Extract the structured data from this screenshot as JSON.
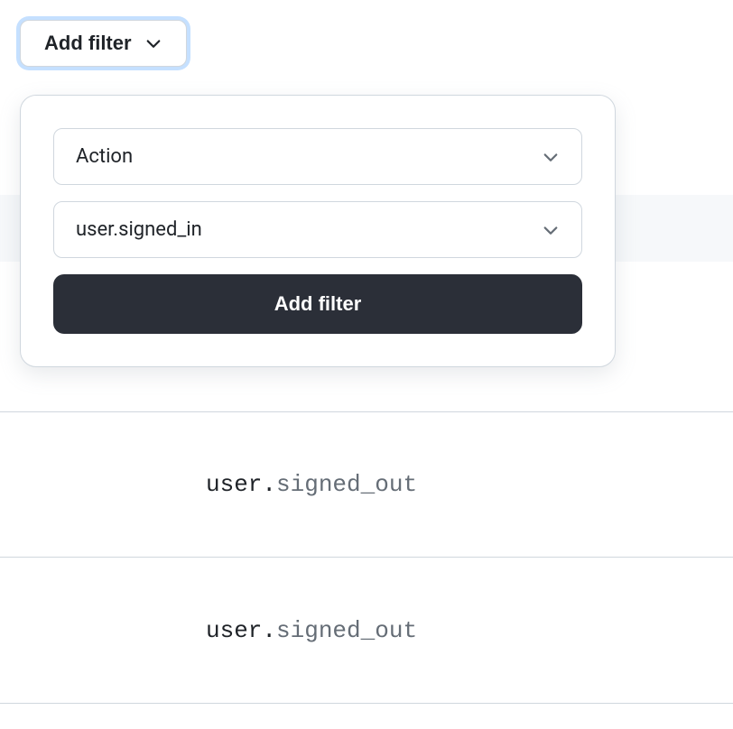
{
  "filter": {
    "trigger_label": "Add filter",
    "popover": {
      "select1_value": "Action",
      "select2_value": "user.signed_in",
      "submit_label": "Add filter"
    }
  },
  "rows": [
    {
      "prefix": "user.",
      "action": "signed_out"
    },
    {
      "prefix": "user.",
      "action": "signed_out"
    }
  ]
}
